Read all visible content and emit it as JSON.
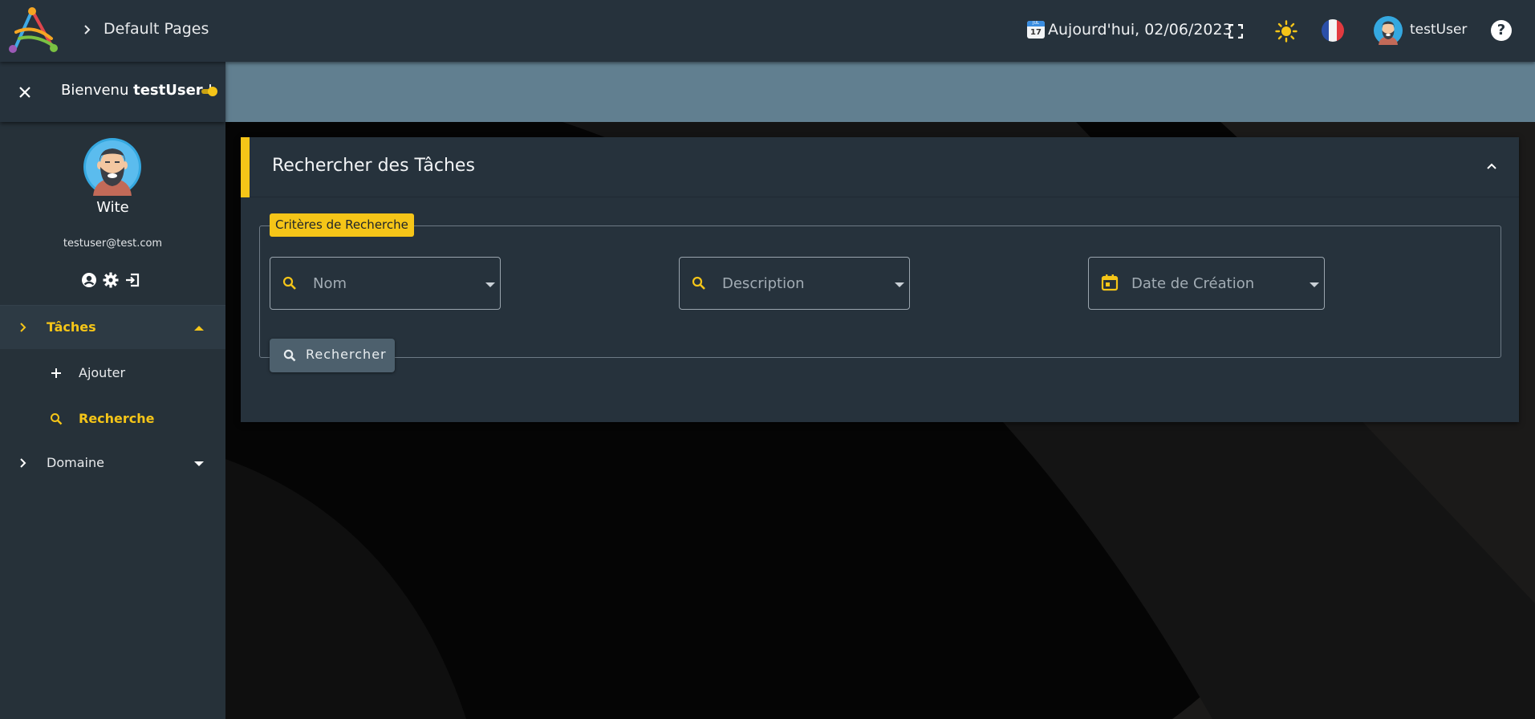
{
  "header": {
    "breadcrumb": "Default Pages",
    "date_label": "Aujourd'hui, 02/06/2023",
    "calendar_badge": {
      "month": "JUL",
      "day": "17"
    },
    "username": "testUser",
    "help_glyph": "?",
    "icons": [
      "logo-icon",
      "chevron-right-icon",
      "calendar-icon",
      "fullscreen-icon",
      "sun-icon",
      "flag-fr-icon",
      "avatar",
      "help-icon"
    ]
  },
  "sidebar": {
    "welcome_prefix": "Bienvenu ",
    "welcome_user": "testUser",
    "welcome_suffix": " !",
    "profile": {
      "name": "Wite",
      "email": "testuser@test.com"
    },
    "nav": [
      {
        "label": "Tâches",
        "active": true,
        "expanded": true,
        "children": [
          {
            "label": "Ajouter",
            "icon": "plus-icon",
            "active": false
          },
          {
            "label": "Recherche",
            "icon": "search-icon",
            "active": true
          }
        ]
      },
      {
        "label": "Domaine",
        "active": false,
        "expanded": false
      }
    ]
  },
  "panel": {
    "title": "Rechercher des Tâches",
    "fieldset_legend": "Critères de Recherche",
    "fields": [
      {
        "placeholder": "Nom",
        "icon": "search-icon",
        "type": "select"
      },
      {
        "placeholder": "Description",
        "icon": "search-icon",
        "type": "select"
      },
      {
        "placeholder": "Date de Création",
        "icon": "calendar-icon",
        "type": "select"
      }
    ],
    "search_button": "Rechercher"
  },
  "colors": {
    "accent": "#f5c518",
    "header_bg": "#26323c",
    "banner_bg": "#617f90",
    "button_bg": "#4d606d"
  }
}
